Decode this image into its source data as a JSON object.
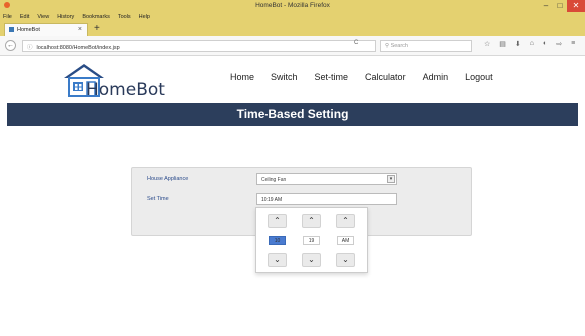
{
  "window": {
    "title": "HomeBot - Mozilla Firefox",
    "minimize": "–",
    "maximize": "□",
    "close": "✕"
  },
  "browser_menu": [
    "File",
    "Edit",
    "View",
    "History",
    "Bookmarks",
    "Tools",
    "Help"
  ],
  "tab": {
    "title": "HomeBot",
    "close": "×",
    "new_tab": "+"
  },
  "address": {
    "url": "localhost:8080/HomeBot/index.jsp",
    "info_icon": "ⓘ",
    "back": "←",
    "reload": "C",
    "search_placeholder": "Search"
  },
  "nav_icons": [
    "☆",
    "▤",
    "⬇",
    "⌂",
    "◐",
    "⇨",
    "≡"
  ],
  "site": {
    "brand": "HomeBot",
    "menu": [
      "Home",
      "Switch",
      "Set-time",
      "Calculator",
      "Admin",
      "Logout"
    ]
  },
  "banner": {
    "title": "Time-Based Setting"
  },
  "form": {
    "appliance_label": "House Appliance",
    "appliance_value": "Ceiling Fan",
    "time_label": "Set Time",
    "time_value": "10:19 AM"
  },
  "time_picker": {
    "up": "⌃",
    "down": "⌄",
    "hour": "10",
    "minute": "19",
    "meridian": "AM"
  },
  "colors": {
    "titlebar": "#e4d170",
    "banner": "#2c3e5c",
    "label_blue": "#2b4b8b",
    "logo_blue": "#3a7bc8"
  }
}
